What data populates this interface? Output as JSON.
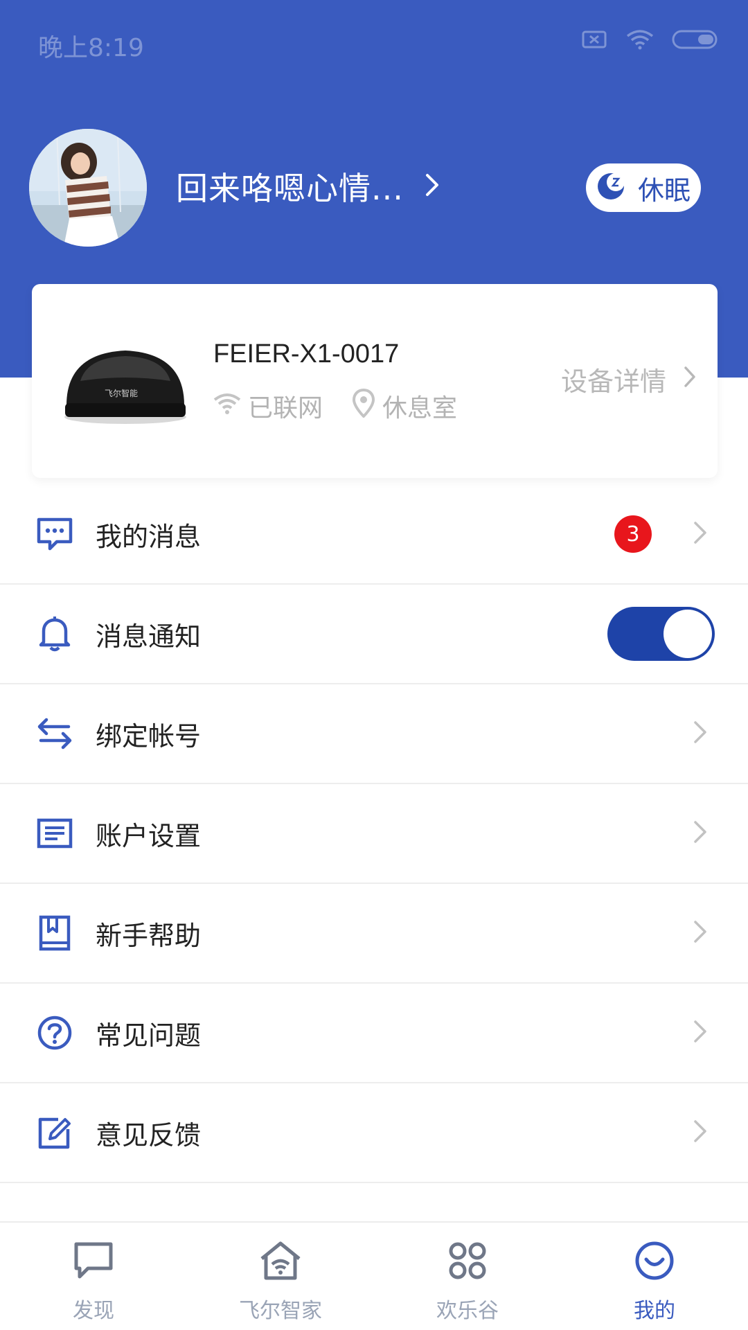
{
  "status_bar": {
    "time": "晚上8:19"
  },
  "profile": {
    "username": "回来咯嗯心情..."
  },
  "sleep_button": {
    "label": "休眠"
  },
  "device": {
    "name": "FEIER-X1-0017",
    "network_status": "已联网",
    "location": "休息室",
    "detail_link": "设备详情",
    "brand_mark": "飞尔智能"
  },
  "menu": {
    "messages": {
      "label": "我的消息",
      "badge": "3"
    },
    "notifications": {
      "label": "消息通知",
      "enabled": true
    },
    "bind_account": {
      "label": "绑定帐号"
    },
    "account_settings": {
      "label": "账户设置"
    },
    "beginner_help": {
      "label": "新手帮助"
    },
    "faq": {
      "label": "常见问题"
    },
    "feedback": {
      "label": "意见反馈"
    }
  },
  "bottom_nav": [
    {
      "label": "发现",
      "icon": "chat-bubble-icon"
    },
    {
      "label": "飞尔智家",
      "icon": "home-wifi-icon"
    },
    {
      "label": "欢乐谷",
      "icon": "apps-grid-icon"
    },
    {
      "label": "我的",
      "icon": "smile-icon",
      "active": true
    }
  ],
  "colors": {
    "primary": "#3a5bbf",
    "toggle_on": "#1e43a8",
    "badge": "#e8161c",
    "inactive_nav": "#9aa4b6"
  }
}
